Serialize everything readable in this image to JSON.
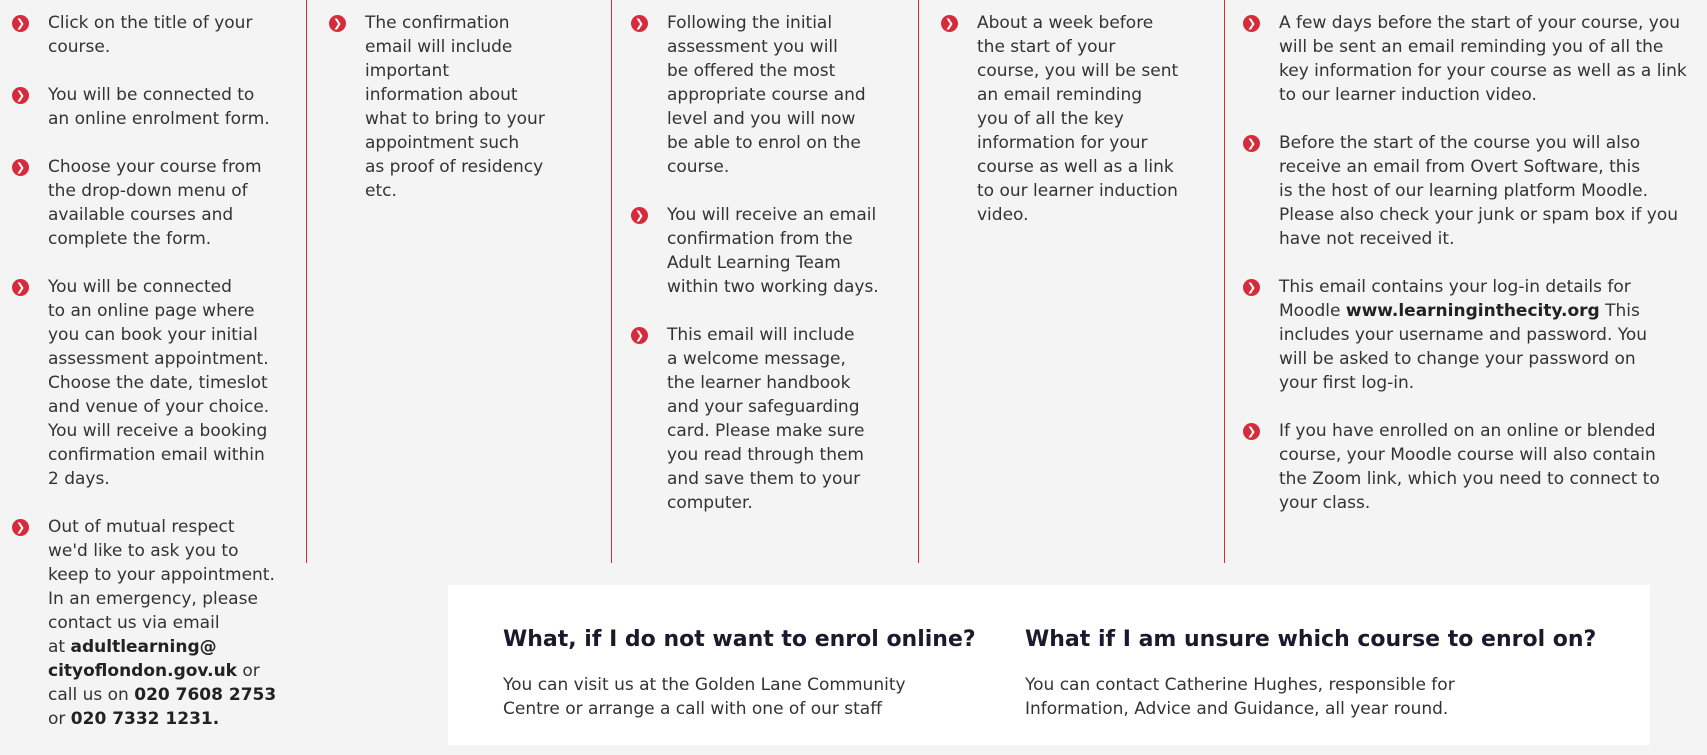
{
  "bullet_icon": "chevron-right-circle",
  "accent_color": "#d62b3a",
  "columns": [
    {
      "steps": [
        {
          "text": "Click on the title of your\ncourse."
        },
        {
          "text": "You will be connected to\nan online enrolment form."
        },
        {
          "text": "Choose your course from\nthe drop-down menu of\navailable courses and\ncomplete the form."
        },
        {
          "text": "You will be connected\nto an online page where\nyou can book your initial\nassessment appointment.\nChoose the date, timeslot\nand venue of your choice.\nYou will receive a booking\nconfirmation email within\n2 days."
        },
        {
          "text": "Out of mutual respect\nwe'd like to ask you to\nkeep to your appointment.\nIn an emergency, please\ncontact us via email\nat ",
          "email": "adultlearning@\ncityoflondon.gov.uk",
          "mid": " or\ncall us on ",
          "phone1": "020 7608 2753",
          "mid2": "\nor ",
          "phone2": "020 7332 1231."
        }
      ]
    },
    {
      "steps": [
        {
          "text": "The confirmation\nemail will include\nimportant\ninformation about\nwhat to bring to your\nappointment such\nas proof of residency\netc."
        }
      ]
    },
    {
      "steps": [
        {
          "text": "Following the initial\nassessment you will\nbe offered the most\nappropriate course and\nlevel and you will now\nbe able to enrol on the\ncourse."
        },
        {
          "text": "You will receive an email\nconfirmation from the\nAdult Learning Team\nwithin two working days."
        },
        {
          "text": "This email will include\na welcome message,\nthe learner handbook\nand your safeguarding\ncard. Please make sure\nyou read through them\nand save them to your\ncomputer."
        }
      ]
    },
    {
      "steps": [
        {
          "text": "About a week before\nthe start of your\ncourse, you will be sent\nan email reminding\nyou of all the key\ninformation for your\ncourse as well as a link\nto our learner induction\nvideo."
        }
      ]
    },
    {
      "steps": [
        {
          "text": "A few days before the start of your course, you\nwill be sent an email reminding you of all the\nkey information for your course as well as a link\nto our learner induction video."
        },
        {
          "text": "Before the start of the course you will also\nreceive an email from Overt Software, this\nis the host of our learning platform Moodle.\nPlease also check your junk or spam box if you\nhave not received it."
        },
        {
          "text": "This email contains your log-in details for\nMoodle ",
          "link": "www.learninginthecity.org",
          "after": " This\nincludes your username and password. You\nwill be asked to change your password on\nyour first log-in."
        },
        {
          "text": "If you have enrolled on an online or blended\ncourse, your Moodle course will also contain\nthe Zoom link, which you need to connect to\nyour class."
        }
      ]
    }
  ],
  "panel": {
    "left": {
      "heading": "What, if I do not want to enrol online?",
      "text": "You can visit us at the Golden Lane Community\nCentre or arrange a call with one of our staff"
    },
    "right": {
      "heading": "What if I am unsure which course to enrol on?",
      "text": "You can contact Catherine Hughes, responsible for\nInformation, Advice and Guidance, all year round."
    }
  }
}
